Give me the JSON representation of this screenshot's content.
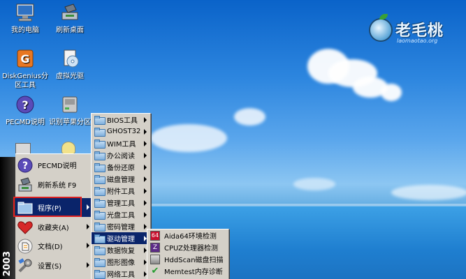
{
  "desktop": {
    "icons": [
      {
        "label": "我的电脑",
        "icon": "computer-icon"
      },
      {
        "label": "刷新桌面",
        "icon": "refresh-desktop-icon"
      },
      {
        "label": "DiskGenius分区工具",
        "icon": "diskgenius-icon"
      },
      {
        "label": "虚拟光驱",
        "icon": "virtual-drive-icon"
      },
      {
        "label": "PECMD说明",
        "icon": "help-icon"
      },
      {
        "label": "识别苹果分区",
        "icon": "disk-icon"
      }
    ],
    "logo": {
      "name": "老毛桃",
      "site": "laomaotao.org"
    }
  },
  "start_menu": {
    "side_label": "2003",
    "items": [
      {
        "label": "PECMD说明",
        "icon": "help-icon",
        "submenu": false
      },
      {
        "label": "刷新系统 F9",
        "icon": "refresh-icon",
        "submenu": false
      },
      {
        "label": "程序(P)",
        "icon": "programs-folder-icon",
        "submenu": true,
        "active": true
      },
      {
        "label": "收藏夹(A)",
        "icon": "favorites-heart-icon",
        "submenu": true
      },
      {
        "label": "文档(D)",
        "icon": "documents-icon",
        "submenu": true
      },
      {
        "label": "设置(S)",
        "icon": "settings-icon",
        "submenu": true
      }
    ]
  },
  "programs_menu": {
    "items": [
      "BIOS工具",
      "GHOST32",
      "WIM工具",
      "办公阅读",
      "备份还原",
      "磁盘管理",
      "附件工具",
      "管理工具",
      "光盘工具",
      "密码管理",
      "驱动管理",
      "数据恢复",
      "图形图像",
      "网络工具"
    ],
    "active_index": 10
  },
  "hardware_menu": {
    "items": [
      {
        "label": "Aida64环境检测",
        "icon": "aida64-icon"
      },
      {
        "label": "CPUZ处理器检测",
        "icon": "cpuz-icon"
      },
      {
        "label": "HddScan磁盘扫描",
        "icon": "hddscan-icon"
      },
      {
        "label": "Memtest内存诊断",
        "icon": "memtest-icon"
      }
    ]
  },
  "colors": {
    "highlight": "#0a246a",
    "menu_bg": "#d4d0c8",
    "selection_box": "#e02020"
  }
}
